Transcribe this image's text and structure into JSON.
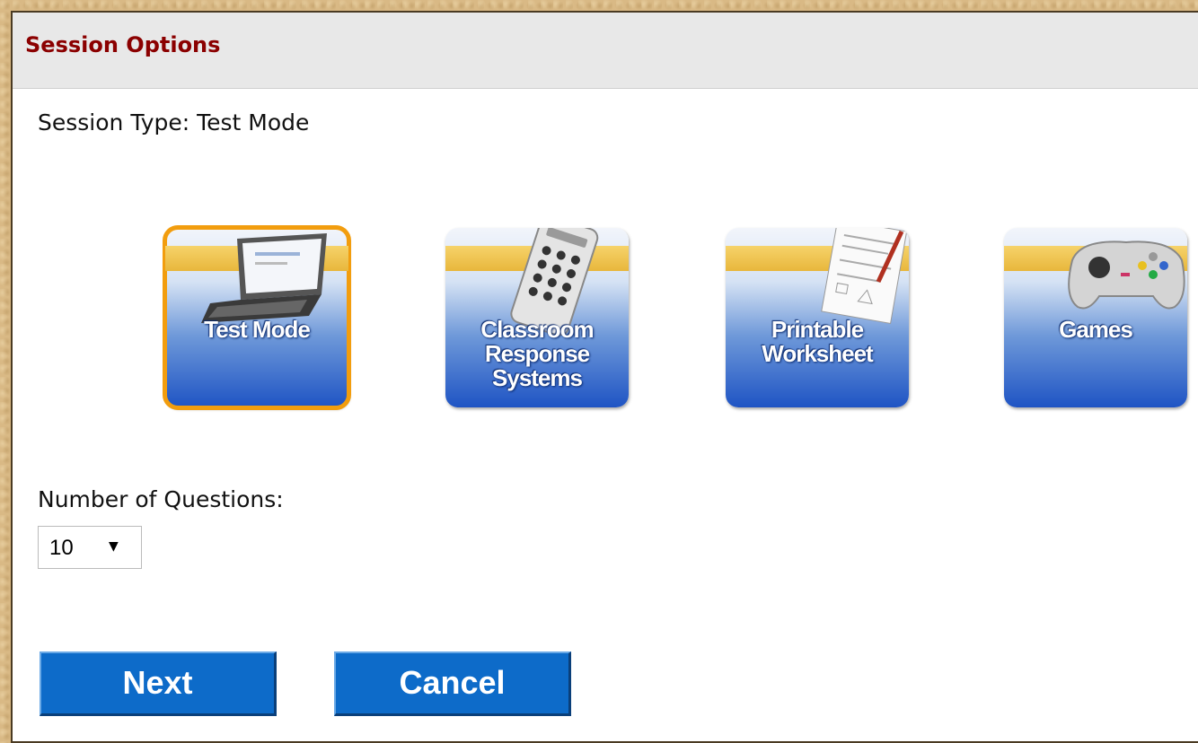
{
  "header": {
    "title": "Session Options"
  },
  "session_type": {
    "text": "Session Type: Test Mode"
  },
  "tiles": [
    {
      "label": "Test Mode",
      "icon": "laptop-icon",
      "selected": true
    },
    {
      "label": "Classroom\nResponse\nSystems",
      "icon": "clicker-remote-icon",
      "selected": false
    },
    {
      "label": "Printable\nWorksheet",
      "icon": "worksheet-icon",
      "selected": false
    },
    {
      "label": "Games",
      "icon": "gamepad-icon",
      "selected": false
    }
  ],
  "questions": {
    "label": "Number of Questions:",
    "selected_value": "10"
  },
  "buttons": {
    "next": "Next",
    "cancel": "Cancel"
  },
  "colors": {
    "header_title": "#8b0000",
    "selected_outline": "#f29d0e",
    "button_blue": "#0d6bc9",
    "tile_blue": "#1f54c4",
    "stripe_gold": "#e8b73c"
  }
}
